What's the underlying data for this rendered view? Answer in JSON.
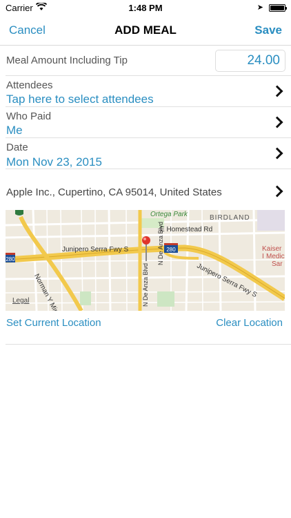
{
  "status_bar": {
    "carrier": "Carrier",
    "time": "1:48 PM"
  },
  "nav": {
    "cancel": "Cancel",
    "title": "ADD MEAL",
    "save": "Save"
  },
  "meal_amount": {
    "label": "Meal Amount Including Tip",
    "value": "24.00"
  },
  "attendees": {
    "label": "Attendees",
    "value": "Tap here to select attendees"
  },
  "who_paid": {
    "label": "Who Paid",
    "value": "Me"
  },
  "date": {
    "label": "Date",
    "value": "Mon Nov 23, 2015"
  },
  "location": {
    "address": "Apple Inc., Cupertino, CA  95014, United States"
  },
  "map": {
    "labels": {
      "ortega_park": "Ortega Park",
      "birdland": "BIRDLAND",
      "homestead": "E Homestead Rd",
      "junipero_main": "Junipero Serra Fwy S",
      "junipero_diag": "Junipero Serra Fwy S",
      "norman": "Norman Y Min",
      "de_anza_1": "N De Anza Blvd",
      "de_anza_2": "N De Anza Blvd",
      "kaiser": "Kaiser I",
      "kaiser2": "Medic",
      "kaiser3": "Sar",
      "legal": "Legal",
      "shield_280": "280",
      "shield_280b": "280",
      "shield_80": "80"
    }
  },
  "actions": {
    "set_current": "Set Current Location",
    "clear": "Clear Location"
  },
  "colors": {
    "accent": "#2a8ec1",
    "map_bg": "#efeadf",
    "freeway": "#f2c94c"
  }
}
